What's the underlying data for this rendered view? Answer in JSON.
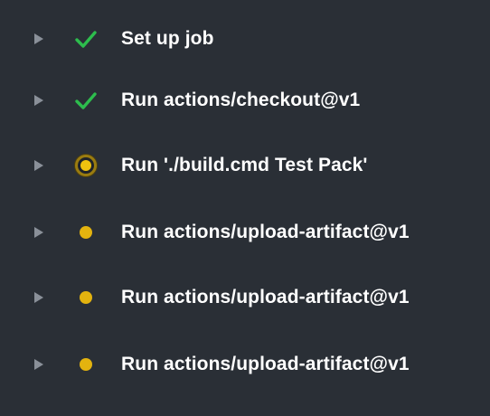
{
  "theme": {
    "background": "#2a2f36",
    "text": "#ffffff",
    "chevron": "#8a9099",
    "success": "#2dbd4d",
    "pending": "#e3b30f",
    "in_progress_ring": "#9a7c10"
  },
  "steps": [
    {
      "label": "Set up job",
      "status": "success",
      "status_icon": "check-icon"
    },
    {
      "label": "Run actions/checkout@v1",
      "status": "success",
      "status_icon": "check-icon"
    },
    {
      "label": "Run './build.cmd Test Pack'",
      "status": "in_progress",
      "status_icon": "spinner-icon"
    },
    {
      "label": "Run actions/upload-artifact@v1",
      "status": "queued",
      "status_icon": "dot-icon"
    },
    {
      "label": "Run actions/upload-artifact@v1",
      "status": "queued",
      "status_icon": "dot-icon"
    },
    {
      "label": "Run actions/upload-artifact@v1",
      "status": "queued",
      "status_icon": "dot-icon"
    }
  ]
}
